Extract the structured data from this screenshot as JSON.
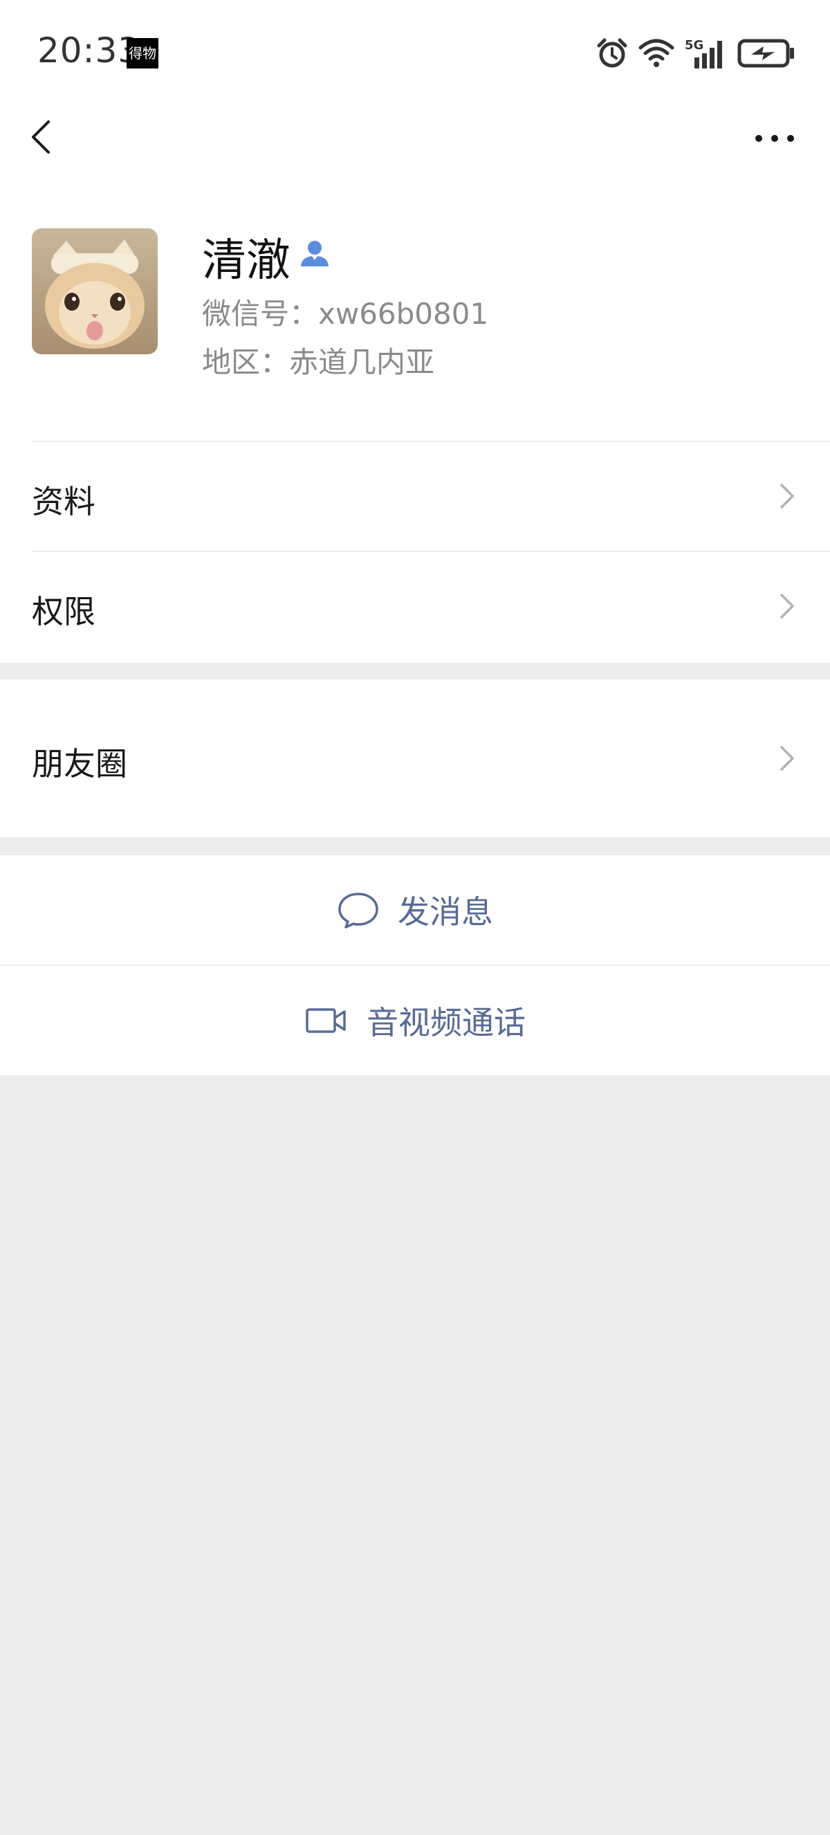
{
  "status_bar": {
    "time": "20:33",
    "app_badge": "得物",
    "icons": [
      "alarm-icon",
      "wifi-icon",
      "5g-signal-icon",
      "battery-charging-icon"
    ],
    "network_label": "5G"
  },
  "nav": {
    "back_icon": "chevron-left-icon",
    "more_icon": "ellipsis-icon"
  },
  "profile": {
    "nickname": "清澈",
    "wechat_id": "微信号：xw66b0801",
    "region": "地区：赤道几内亚",
    "verify_icon": "contact-person-icon",
    "verify_color": "#5b8ddd"
  },
  "menu": {
    "info_label": "资料",
    "permission_label": "权限",
    "moments_label": "朋友圈"
  },
  "actions": {
    "message_label": "发消息",
    "call_label": "音视频通话",
    "link_color": "#576b95"
  }
}
